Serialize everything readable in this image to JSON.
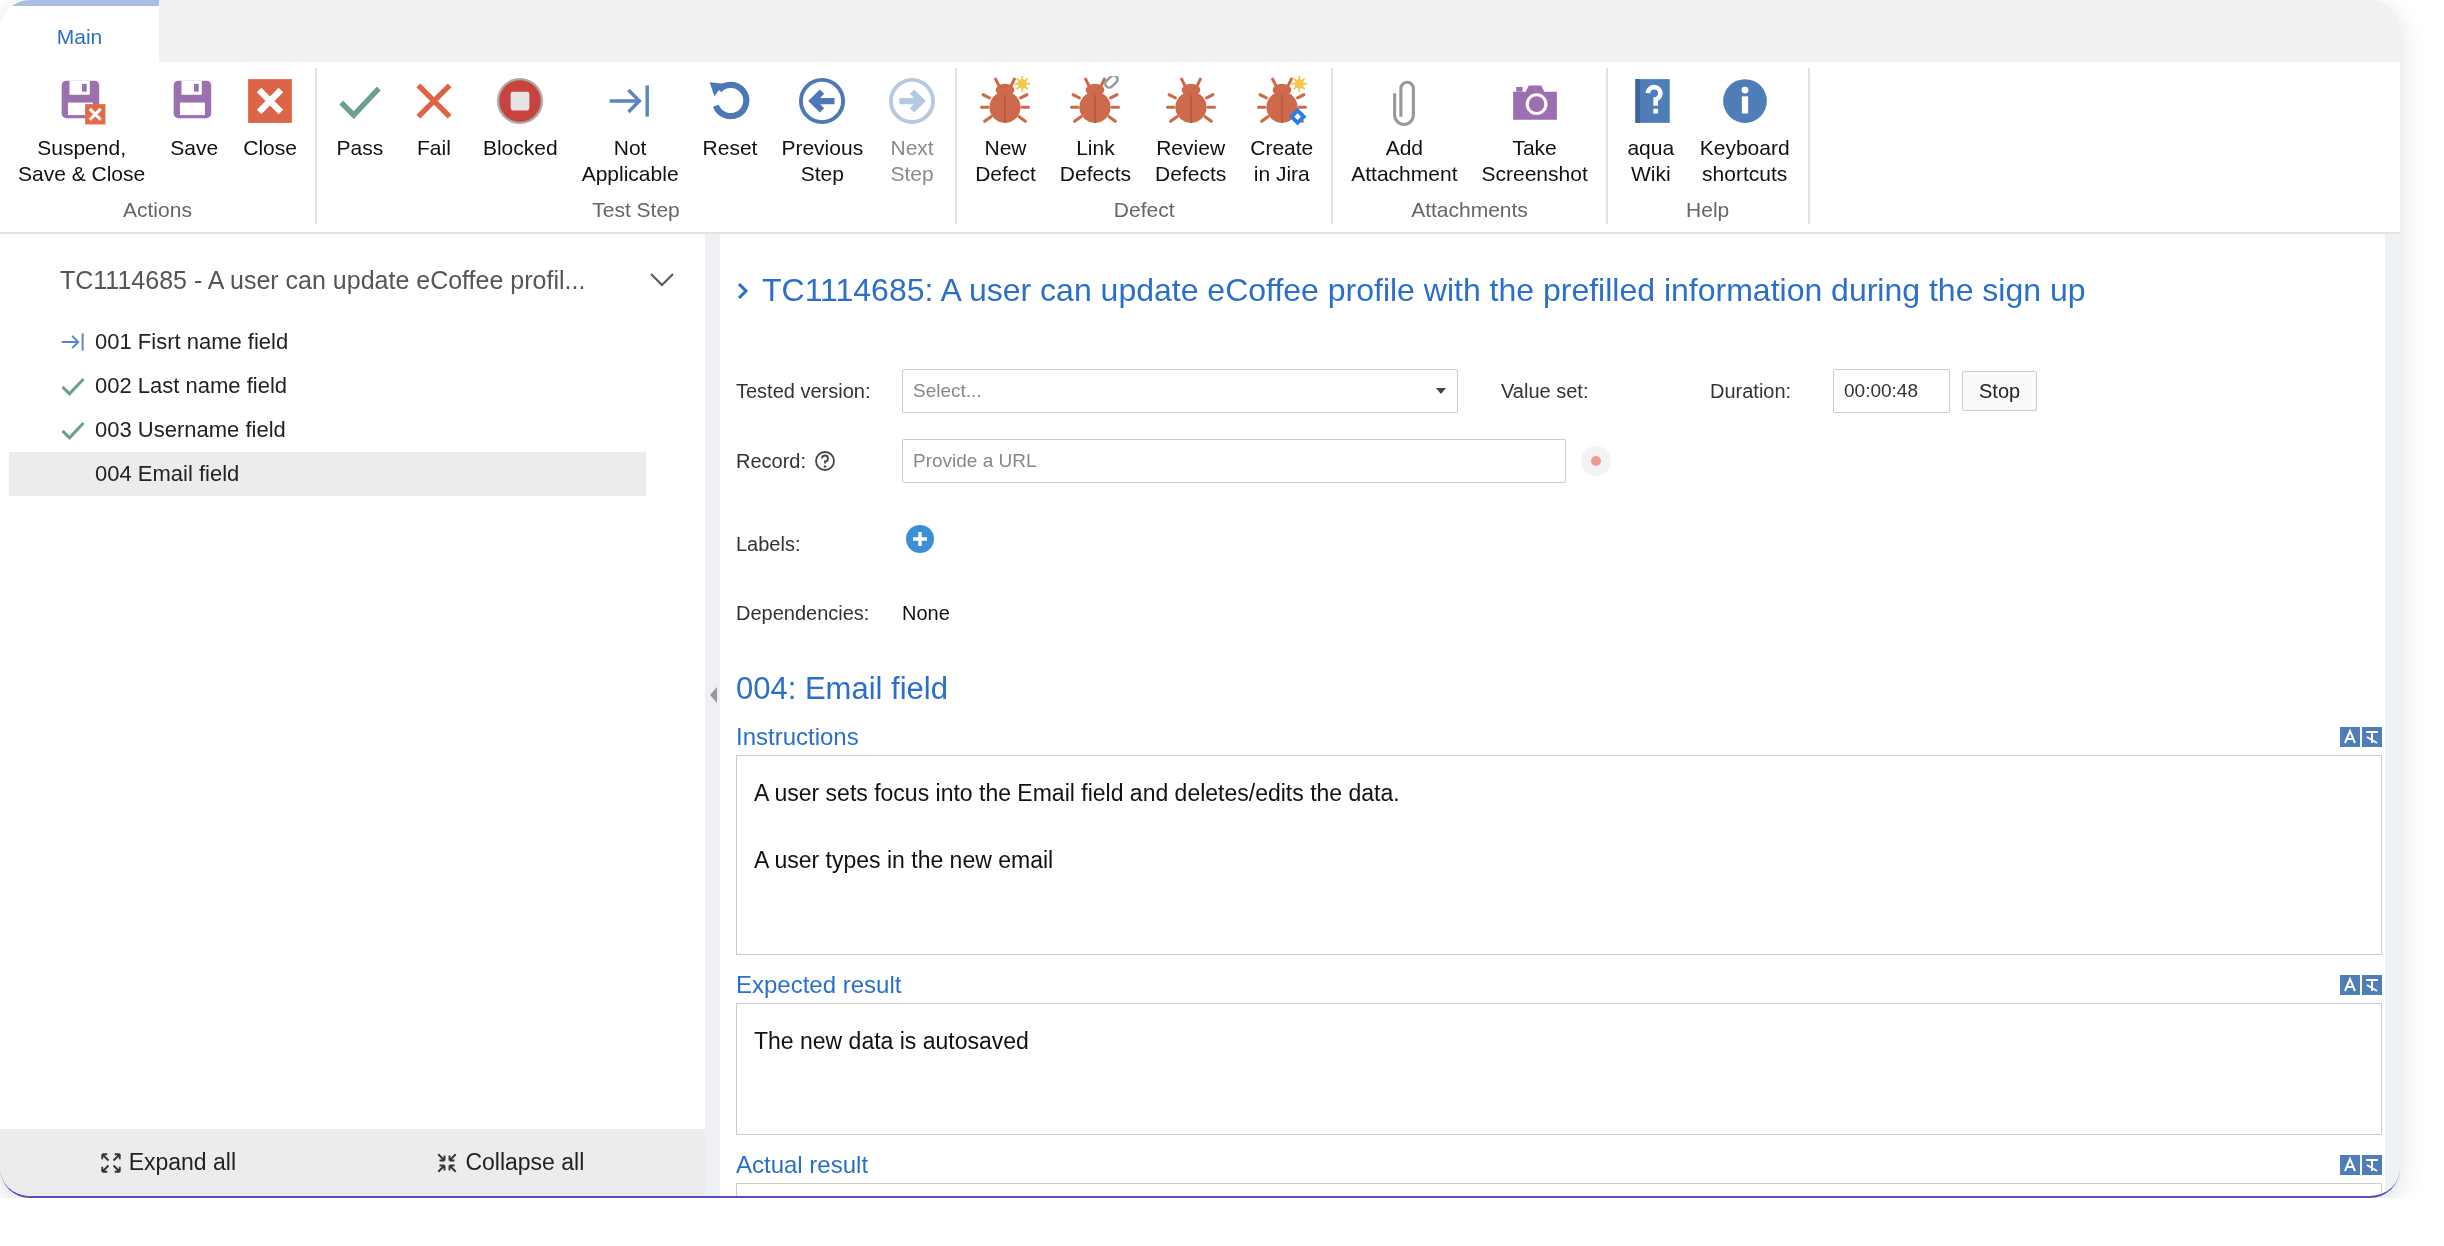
{
  "tabs": [
    {
      "label": "Main",
      "selected": true
    }
  ],
  "ribbon": {
    "groups": [
      {
        "label": "Actions",
        "buttons": [
          {
            "kind": "suspend",
            "label": "Suspend,\nSave & Close",
            "disabled": false
          },
          {
            "kind": "save",
            "label": "Save",
            "disabled": false
          },
          {
            "kind": "close",
            "label": "Close",
            "disabled": false
          }
        ]
      },
      {
        "label": "Test Step",
        "buttons": [
          {
            "kind": "pass",
            "label": "Pass",
            "disabled": false
          },
          {
            "kind": "fail",
            "label": "Fail",
            "disabled": false
          },
          {
            "kind": "blocked",
            "label": "Blocked",
            "disabled": false
          },
          {
            "kind": "not-applicable",
            "label": "Not\nApplicable",
            "disabled": false
          },
          {
            "kind": "reset",
            "label": "Reset",
            "disabled": false
          },
          {
            "kind": "previous",
            "label": "Previous\nStep",
            "disabled": false
          },
          {
            "kind": "next",
            "label": "Next\nStep",
            "disabled": true
          }
        ]
      },
      {
        "label": "Defect",
        "buttons": [
          {
            "kind": "new-defect",
            "label": "New\nDefect",
            "disabled": false
          },
          {
            "kind": "link-defects",
            "label": "Link\nDefects",
            "disabled": false
          },
          {
            "kind": "review-defects",
            "label": "Review\nDefects",
            "disabled": false
          },
          {
            "kind": "create-jira",
            "label": "Create\nin Jira",
            "disabled": false
          }
        ]
      },
      {
        "label": "Attachments",
        "buttons": [
          {
            "kind": "attachment",
            "label": "Add\nAttachment",
            "disabled": false
          },
          {
            "kind": "screenshot",
            "label": "Take\nScreenshot",
            "disabled": false
          }
        ]
      },
      {
        "label": "Help",
        "buttons": [
          {
            "kind": "wiki",
            "label": "aqua\nWiki",
            "disabled": false
          },
          {
            "kind": "info",
            "label": "Keyboard\nshortcuts",
            "disabled": false
          }
        ]
      }
    ]
  },
  "steps_panel": {
    "title": "TC1114685 - A user can update eCoffee profil...",
    "steps": [
      {
        "label": "001 Fisrt name field",
        "kind": "not-applicable",
        "selected": false
      },
      {
        "label": "002 Last name field",
        "kind": "passed",
        "selected": false
      },
      {
        "label": "003 Username field",
        "kind": "passed",
        "selected": false
      },
      {
        "label": "004 Email field",
        "kind": "unrun",
        "selected": true
      }
    ],
    "footer": [
      {
        "kind": "expand",
        "label": "Expand all"
      },
      {
        "kind": "collapse",
        "label": "Collapse all"
      }
    ]
  },
  "details": {
    "title": "TC1114685: A user can update eCoffee profile with the prefilled information during the sign up",
    "tested_version": {
      "label": "Tested version:",
      "placeholder": "Select..."
    },
    "value_set": {
      "label": "Value set:"
    },
    "duration": {
      "label": "Duration:",
      "value": "00:00:48",
      "button": "Stop"
    },
    "record": {
      "label": "Record:",
      "placeholder": "Provide a URL"
    },
    "labels": {
      "label": "Labels:"
    },
    "dependencies": {
      "label": "Dependencies:",
      "value": "None"
    },
    "step_title": "004: Email field",
    "sections": [
      {
        "label": "Instructions",
        "paragraphs": [
          "A user sets focus into the Email field and deletes/edits the data.",
          "A user types in the new email"
        ]
      },
      {
        "label": "Expected result",
        "paragraphs": [
          "The new data is autosaved"
        ]
      },
      {
        "label": "Actual result"
      }
    ]
  }
}
